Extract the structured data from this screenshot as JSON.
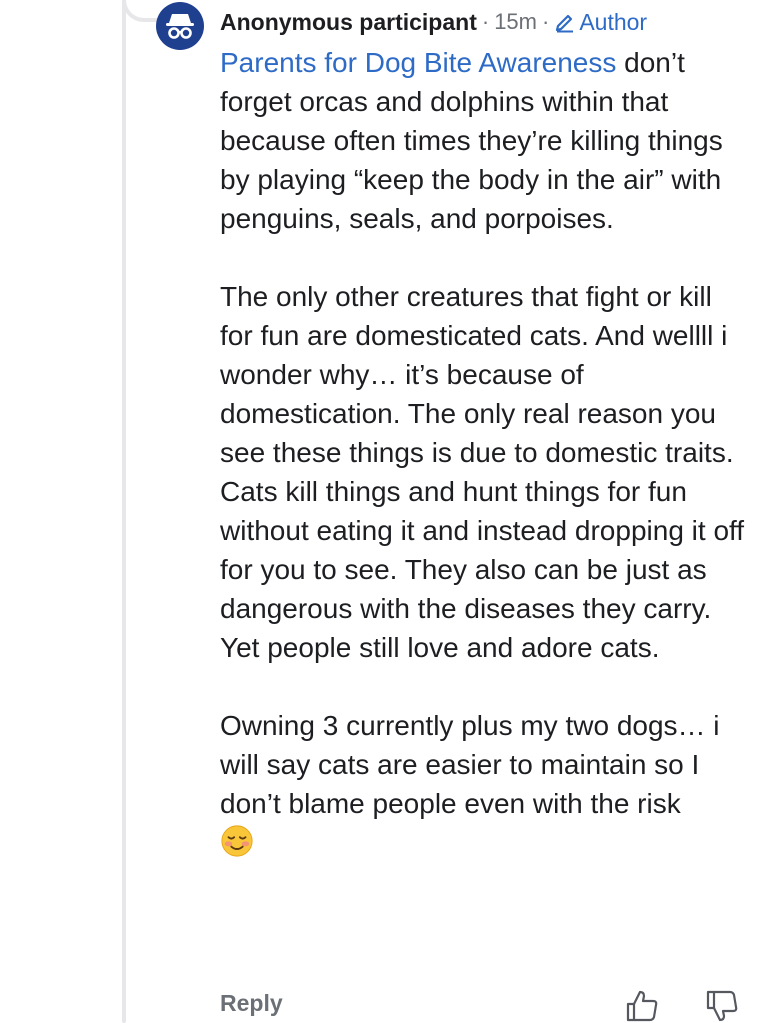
{
  "comment": {
    "author": "Anonymous participant",
    "separator": "·",
    "time": "15m",
    "badge": "Author",
    "mention": "Parents for Dog Bite Awareness",
    "paragraph1_rest": " don’t forget orcas and dolphins within that because often times they’re killing things by playing “keep the body in the air” with penguins, seals, and porpoises.",
    "paragraph2": "The only other creatures that fight or kill for fun are domesticated cats. And wellll i wonder why… it’s because of domestication. The only real reason you see these things is due to domestic traits. Cats kill things and hunt things for fun without eating it and instead dropping it off for you to see. They also can be just as dangerous with the diseases they carry. Yet people still love and adore cats.",
    "paragraph3": "Owning 3 currently plus my two dogs… i will say cats are easier to maintain so I don’t blame people even with the risk",
    "emoji": "smiling-face-with-blush",
    "reply_label": "Reply"
  },
  "colors": {
    "link": "#2e6bc6",
    "avatar_bg": "#1f3f8f",
    "muted": "#6b6f76",
    "thread_line": "#e7e7ea"
  },
  "icons": {
    "avatar": "incognito-icon",
    "badge": "pencil-icon",
    "like": "thumbs-up-icon",
    "dislike": "thumbs-down-icon"
  }
}
